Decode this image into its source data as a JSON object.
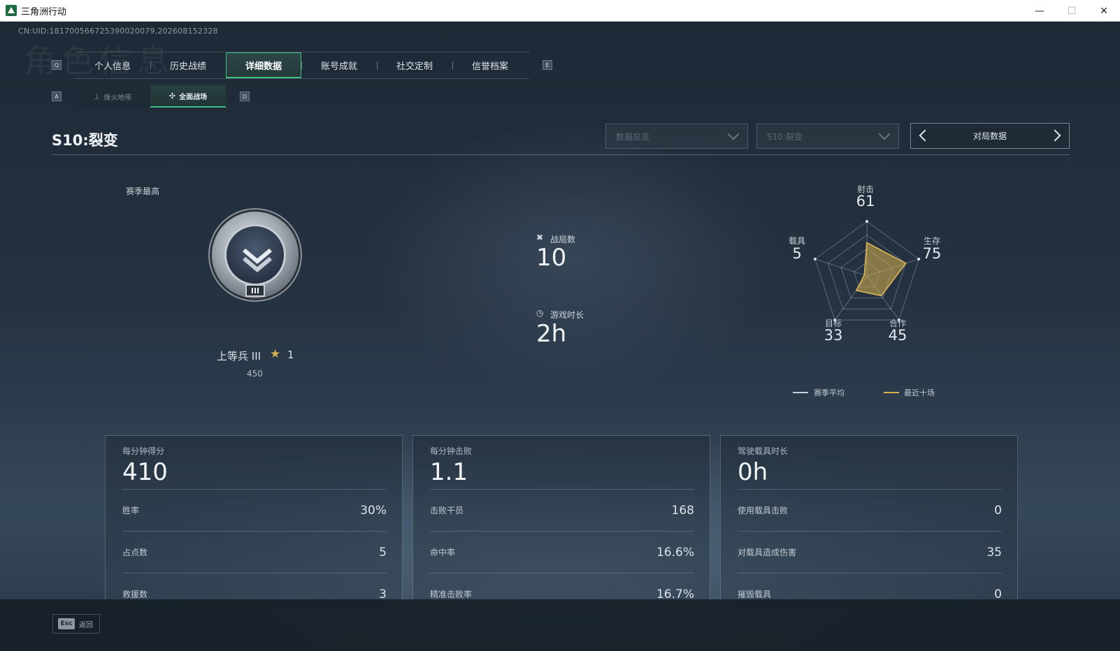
{
  "window": {
    "title": "三角洲行动"
  },
  "header": {
    "uid": "CN:UID:181700566725390020079,202608152328",
    "bg_text": "角色信息",
    "key_left": "Q",
    "key_right": "E",
    "key_sub_left": "A",
    "key_sub_right": "D",
    "tabs": [
      {
        "label": "个人信息"
      },
      {
        "label": "历史战绩"
      },
      {
        "label": "详细数据"
      },
      {
        "label": "账号成就"
      },
      {
        "label": "社交定制"
      },
      {
        "label": "信誉档案"
      }
    ],
    "active_tab": 2,
    "subtabs": [
      {
        "label": "烽火地带",
        "icon": "crosshair-icon"
      },
      {
        "label": "全面战场",
        "icon": "plane-icon"
      }
    ],
    "active_subtab": 1
  },
  "season": {
    "title": "S10:裂变",
    "filter_overview": "数据总览",
    "filter_season": "S10:裂变",
    "match_data": "对局数据"
  },
  "rank": {
    "season_best_label": "赛季最高",
    "name": "上等兵 III",
    "badge_roman": "III",
    "stars": "1",
    "points": "450"
  },
  "summary": {
    "matches_label": "战局数",
    "matches_value": "10",
    "playtime_label": "游戏时长",
    "playtime_value": "2h"
  },
  "radar": {
    "axes": [
      {
        "label": "射击",
        "value": "61",
        "score": 0.61
      },
      {
        "label": "生存",
        "value": "75",
        "score": 0.75
      },
      {
        "label": "合作",
        "value": "45",
        "score": 0.45
      },
      {
        "label": "目标",
        "value": "33",
        "score": 0.33
      },
      {
        "label": "载具",
        "value": "5",
        "score": 0.05
      }
    ],
    "legend_season": "赛季平均",
    "legend_recent": "最近十场",
    "color_season": "#c9d1d8",
    "color_recent": "#d8b24f"
  },
  "panels": [
    {
      "title": "每分钟得分",
      "main": "410",
      "rows": [
        {
          "label": "胜率",
          "value": "30%"
        },
        {
          "label": "占点数",
          "value": "5"
        },
        {
          "label": "救援数",
          "value": "3"
        }
      ]
    },
    {
      "title": "每分钟击败",
      "main": "1.1",
      "rows": [
        {
          "label": "击败干员",
          "value": "168"
        },
        {
          "label": "命中率",
          "value": "16.6%"
        },
        {
          "label": "精准击败率",
          "value": "16.7%"
        }
      ]
    },
    {
      "title": "驾驶载具时长",
      "main": "0h",
      "rows": [
        {
          "label": "使用载具击败",
          "value": "0"
        },
        {
          "label": "对载具造成伤害",
          "value": "35"
        },
        {
          "label": "摧毁载具",
          "value": "0"
        }
      ]
    }
  ],
  "footer": {
    "esc_key": "Esc",
    "back_label": "返回"
  }
}
